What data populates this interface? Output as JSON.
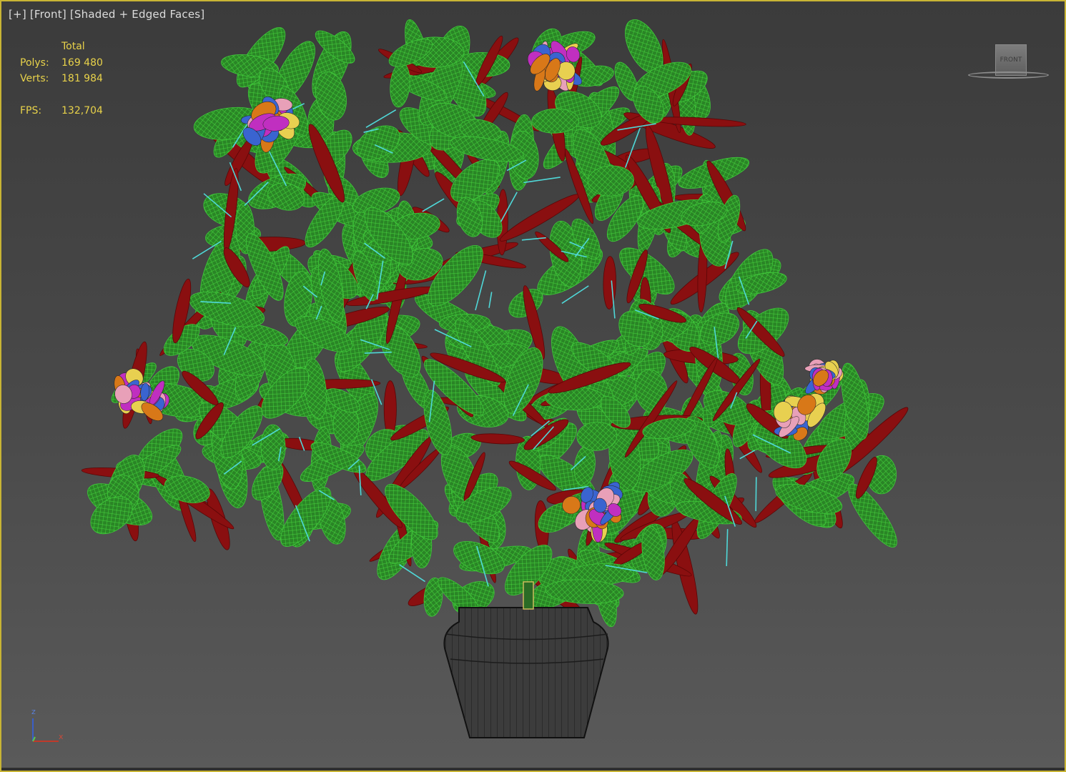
{
  "viewport": {
    "label_plus": "[+]",
    "label_view": "[Front]",
    "label_shading": "[Shaded + Edged Faces]",
    "border_color": "#c8b434"
  },
  "stats": {
    "header": "Total",
    "polys_label": "Polys:",
    "polys_value": "169 480",
    "verts_label": "Verts:",
    "verts_value": "181 984",
    "fps_label": "FPS:",
    "fps_value": "132,704",
    "text_color": "#e8d24a"
  },
  "viewcube": {
    "face_label": "FRONT"
  },
  "axis_gizmo": {
    "z_label": "z",
    "x_label": "x"
  },
  "scene": {
    "object": "potted-plant",
    "leaf_color": "#2e8a2a",
    "wire_color": "#3fc93a",
    "red_leaf_color": "#8a0f10",
    "stem_color": "#4fd8d8",
    "pot_color": "#3a3a3a",
    "flower_colors": [
      "#c02fc0",
      "#e8d050",
      "#3a64d0",
      "#e8a0b8",
      "#d87818"
    ]
  }
}
